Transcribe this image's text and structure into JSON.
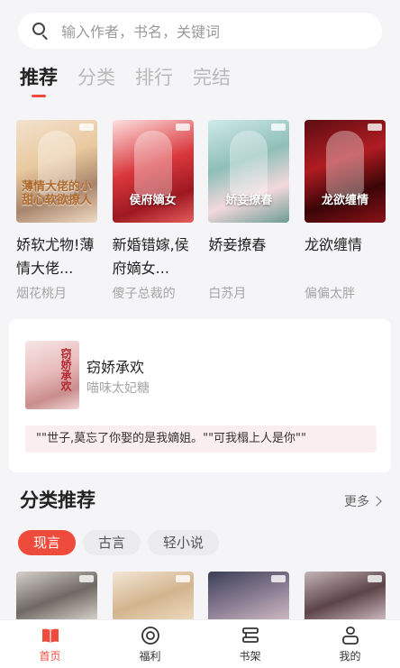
{
  "search": {
    "placeholder": "输入作者，书名，关键词",
    "icon": "search-icon"
  },
  "top_tabs": [
    {
      "label": "推荐",
      "active": true
    },
    {
      "label": "分类",
      "active": false
    },
    {
      "label": "排行",
      "active": false
    },
    {
      "label": "完结",
      "active": false
    }
  ],
  "recommended_books": [
    {
      "title": "娇软尤物!薄情大佬...",
      "author": "烟花桃月",
      "cover_art": "薄情大佬的小甜心软欲撩人"
    },
    {
      "title": "新婚错嫁,侯府嫡女...",
      "author": "傻子总裁的",
      "cover_art": "侯府嫡女"
    },
    {
      "title": "娇妾撩春",
      "author": "白苏月",
      "cover_art": "娇妾撩春"
    },
    {
      "title": "龙欲缠情",
      "author": "偏偏太胖",
      "cover_art": "龙欲缠情"
    }
  ],
  "featured": {
    "title": "窃娇承欢",
    "author": "喵味太妃糖",
    "cover_art": "窃娇承欢",
    "quote": "\"\"世子,莫忘了你娶的是我嫡姐。\"\"可我榻上人是你\"\""
  },
  "category_section": {
    "title": "分类推荐",
    "more_label": "更多",
    "pills": [
      {
        "label": "现言",
        "active": true
      },
      {
        "label": "古言",
        "active": false
      },
      {
        "label": "轻小说",
        "active": false
      }
    ]
  },
  "bottom_nav": [
    {
      "label": "首页",
      "icon": "book-open-icon",
      "active": true
    },
    {
      "label": "福利",
      "icon": "target-icon",
      "active": false
    },
    {
      "label": "书架",
      "icon": "bookshelf-icon",
      "active": false
    },
    {
      "label": "我的",
      "icon": "user-icon",
      "active": false
    }
  ],
  "colors": {
    "accent": "#ef4b3c",
    "background": "#f5f5f7",
    "muted_text": "#a6a6a6"
  }
}
